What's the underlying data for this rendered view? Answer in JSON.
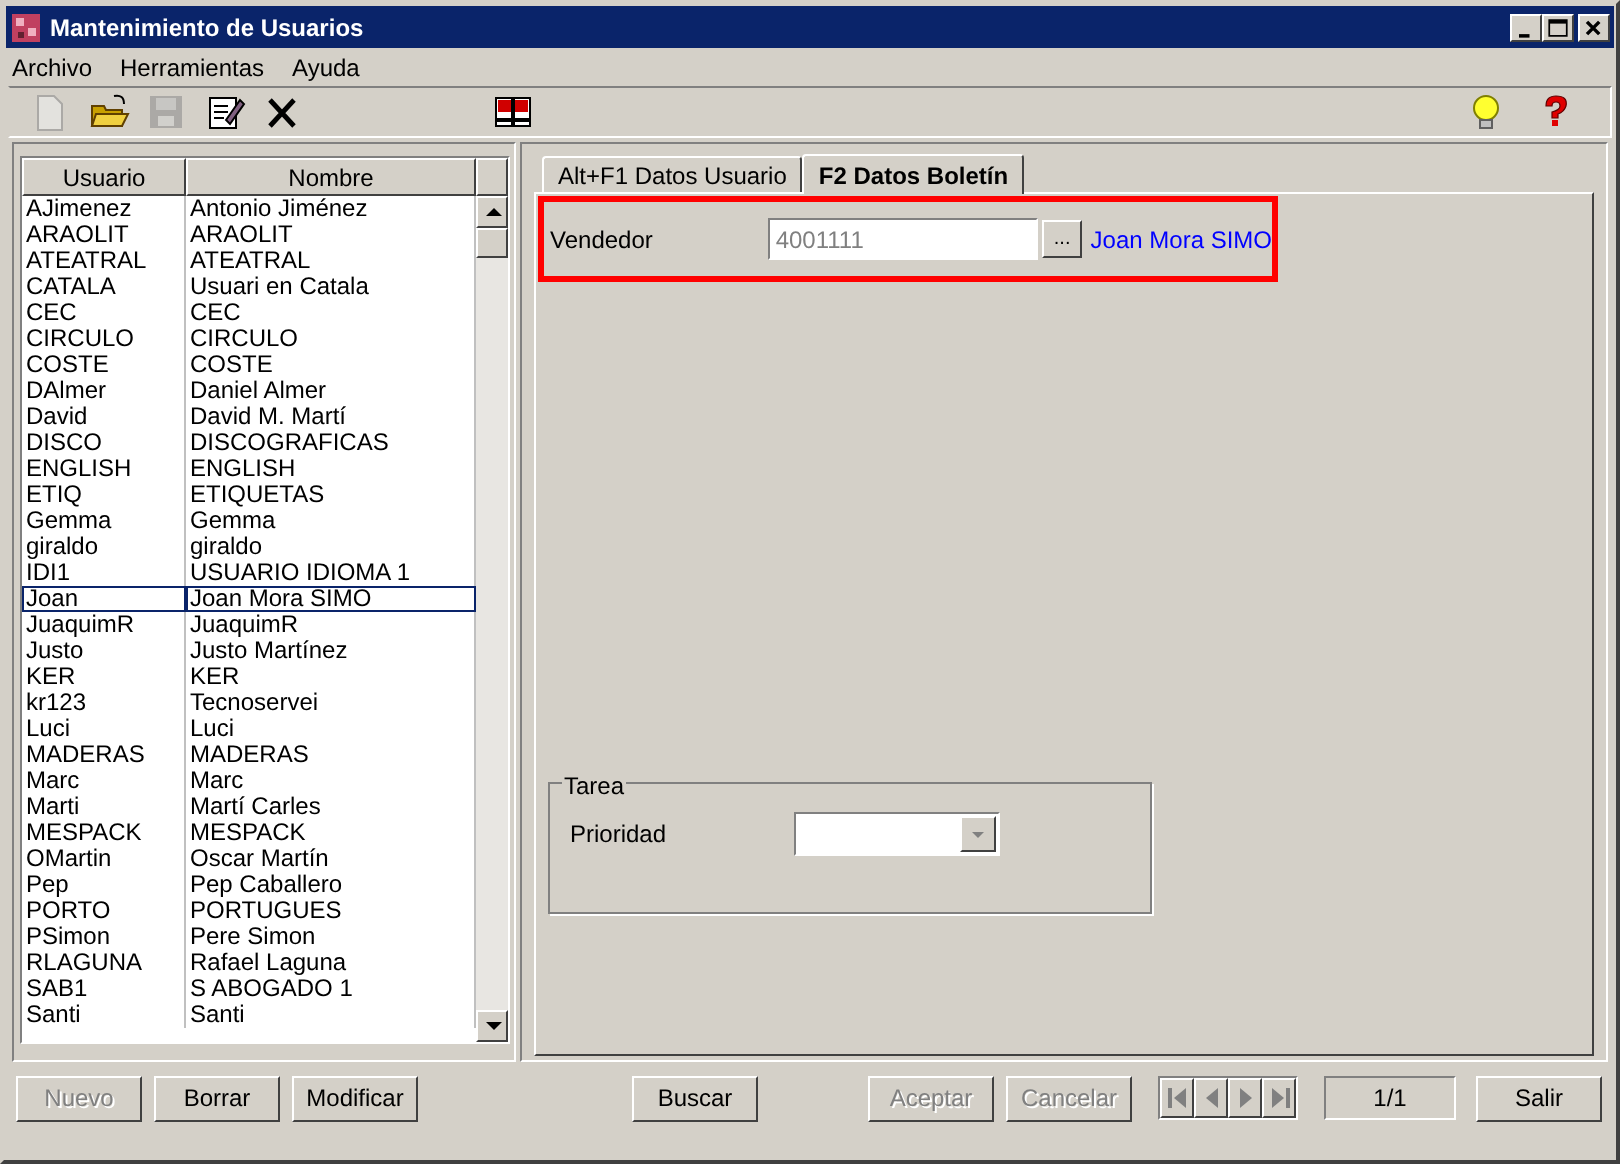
{
  "window": {
    "title": "Mantenimiento de Usuarios"
  },
  "menu": [
    "Archivo",
    "Herramientas",
    "Ayuda"
  ],
  "toolbar": [
    {
      "kind": "new",
      "disabled": true
    },
    {
      "kind": "open",
      "disabled": false
    },
    {
      "kind": "save",
      "disabled": true
    },
    {
      "kind": "edit",
      "disabled": false
    },
    {
      "kind": "delete",
      "disabled": false
    },
    {
      "kind": "book",
      "disabled": false
    }
  ],
  "toolbar_right": [
    {
      "kind": "bulb"
    },
    {
      "kind": "help"
    }
  ],
  "table": {
    "columns": [
      "Usuario",
      "Nombre"
    ],
    "rows": [
      {
        "usuario": "AJimenez",
        "nombre": "Antonio Jiménez",
        "selected": false
      },
      {
        "usuario": "ARAOLIT",
        "nombre": "ARAOLIT",
        "selected": false
      },
      {
        "usuario": "ATEATRAL",
        "nombre": "ATEATRAL",
        "selected": false
      },
      {
        "usuario": "CATALA",
        "nombre": "Usuari en Catala",
        "selected": false
      },
      {
        "usuario": "CEC",
        "nombre": "CEC",
        "selected": false
      },
      {
        "usuario": "CIRCULO",
        "nombre": "CIRCULO",
        "selected": false
      },
      {
        "usuario": "COSTE",
        "nombre": "COSTE",
        "selected": false
      },
      {
        "usuario": "DAlmer",
        "nombre": "Daniel Almer",
        "selected": false
      },
      {
        "usuario": "David",
        "nombre": "David M. Martí",
        "selected": false
      },
      {
        "usuario": "DISCO",
        "nombre": "DISCOGRAFICAS",
        "selected": false
      },
      {
        "usuario": "ENGLISH",
        "nombre": "ENGLISH",
        "selected": false
      },
      {
        "usuario": "ETIQ",
        "nombre": "ETIQUETAS",
        "selected": false
      },
      {
        "usuario": "Gemma",
        "nombre": "Gemma",
        "selected": false
      },
      {
        "usuario": "giraldo",
        "nombre": "giraldo",
        "selected": false
      },
      {
        "usuario": "IDI1",
        "nombre": "USUARIO IDIOMA 1",
        "selected": false
      },
      {
        "usuario": "Joan",
        "nombre": "Joan Mora SIMO",
        "selected": true
      },
      {
        "usuario": "JuaquimR",
        "nombre": "JuaquimR",
        "selected": false
      },
      {
        "usuario": "Justo",
        "nombre": "Justo Martínez",
        "selected": false
      },
      {
        "usuario": "KER",
        "nombre": "KER",
        "selected": false
      },
      {
        "usuario": "kr123",
        "nombre": "Tecnoservei",
        "selected": false
      },
      {
        "usuario": "Luci",
        "nombre": "Luci",
        "selected": false
      },
      {
        "usuario": "MADERAS",
        "nombre": "MADERAS",
        "selected": false
      },
      {
        "usuario": "Marc",
        "nombre": "Marc",
        "selected": false
      },
      {
        "usuario": "Marti",
        "nombre": "Martí Carles",
        "selected": false
      },
      {
        "usuario": "MESPACK",
        "nombre": "MESPACK",
        "selected": false
      },
      {
        "usuario": "OMartin",
        "nombre": "Oscar Martín",
        "selected": false
      },
      {
        "usuario": "Pep",
        "nombre": "Pep Caballero",
        "selected": false
      },
      {
        "usuario": "PORTO",
        "nombre": "PORTUGUES",
        "selected": false
      },
      {
        "usuario": "PSimon",
        "nombre": "Pere Simon",
        "selected": false
      },
      {
        "usuario": "RLAGUNA",
        "nombre": "Rafael Laguna",
        "selected": false
      },
      {
        "usuario": "SAB1",
        "nombre": "S ABOGADO 1",
        "selected": false
      },
      {
        "usuario": "Santi",
        "nombre": "Santi",
        "selected": false
      }
    ]
  },
  "tabs": [
    {
      "label": "Alt+F1 Datos Usuario",
      "selected": false
    },
    {
      "label": "F2 Datos Boletín",
      "selected": true
    }
  ],
  "vendedor": {
    "label": "Vendedor",
    "value": "4001111",
    "browse": "...",
    "name": "Joan Mora SIMO"
  },
  "tarea": {
    "title": "Tarea",
    "prioridad_label": "Prioridad"
  },
  "buttons_left": [
    {
      "label": "Nuevo",
      "disabled": true
    },
    {
      "label": "Borrar",
      "disabled": false
    },
    {
      "label": "Modificar",
      "disabled": false
    }
  ],
  "search_button": {
    "label": "Buscar",
    "disabled": false
  },
  "buttons_mid": [
    {
      "label": "Aceptar",
      "disabled": true
    },
    {
      "label": "Cancelar",
      "disabled": true
    }
  ],
  "record_counter": "1/1",
  "exit_button": {
    "label": "Salir",
    "disabled": false
  }
}
